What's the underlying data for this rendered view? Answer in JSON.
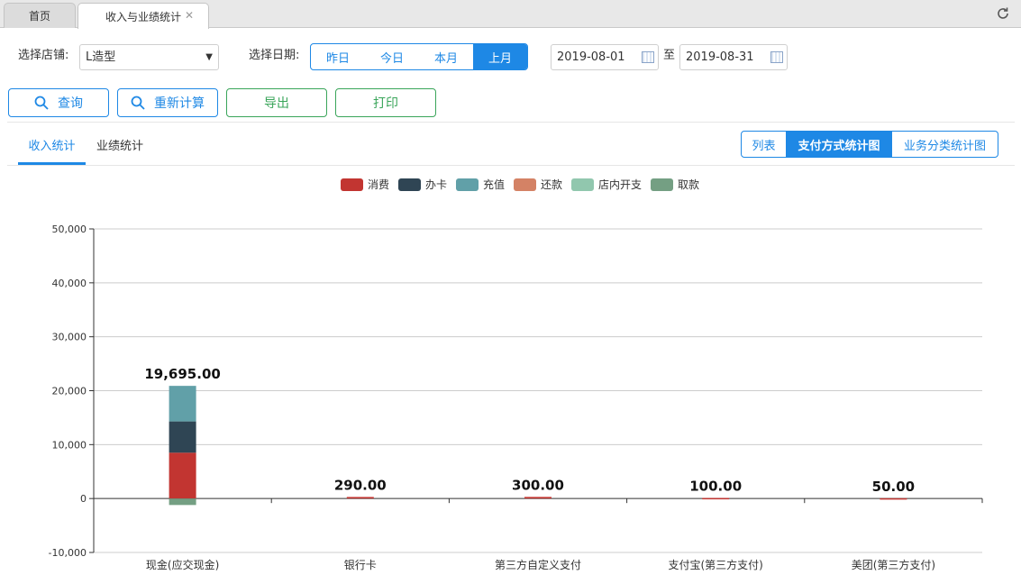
{
  "tabs": {
    "home": "首页",
    "active": "收入与业绩统计"
  },
  "filters": {
    "store_label": "选择店铺:",
    "store_value": "L造型",
    "date_label": "选择日期:",
    "date_options": [
      "昨日",
      "今日",
      "本月",
      "上月"
    ],
    "date_selected": "上月",
    "start_date": "2019-08-01",
    "to_label": "至",
    "end_date": "2019-08-31"
  },
  "actions": {
    "query": "查询",
    "recalc": "重新计算",
    "export": "导出",
    "print": "打印"
  },
  "subtabs": [
    "收入统计",
    "业绩统计"
  ],
  "view_options": [
    "列表",
    "支付方式统计图",
    "业务分类统计图"
  ],
  "view_selected": "支付方式统计图",
  "colors": {
    "accent": "#1e88e5",
    "green": "#3aa55a"
  },
  "chart_data": {
    "type": "bar",
    "stacked": true,
    "categories": [
      "现金(应交现金)",
      "银行卡",
      "第三方自定义支付",
      "支付宝(第三方支付)",
      "美团(第三方支付)"
    ],
    "series": [
      {
        "name": "消费",
        "color": "#c23531",
        "values": [
          8500,
          290,
          300,
          100,
          50
        ]
      },
      {
        "name": "办卡",
        "color": "#2f4554",
        "values": [
          5800,
          0,
          0,
          0,
          0
        ]
      },
      {
        "name": "充值",
        "color": "#61a0a8",
        "values": [
          6595,
          0,
          0,
          0,
          0
        ]
      },
      {
        "name": "还款",
        "color": "#d48265",
        "values": [
          0,
          0,
          0,
          0,
          0
        ]
      },
      {
        "name": "店内开支",
        "color": "#91c7ae",
        "values": [
          0,
          0,
          0,
          0,
          0
        ]
      },
      {
        "name": "取款",
        "color": "#749f83",
        "values": [
          -1200,
          0,
          0,
          0,
          0
        ]
      }
    ],
    "totals": [
      "19,695.00",
      "290.00",
      "300.00",
      "100.00",
      "50.00"
    ],
    "yticks": [
      "50,000",
      "40,000",
      "30,000",
      "20,000",
      "10,000",
      "0",
      "-10,000"
    ],
    "ylim": [
      -10000,
      50000
    ],
    "grid": true,
    "legend_position": "top-center"
  }
}
